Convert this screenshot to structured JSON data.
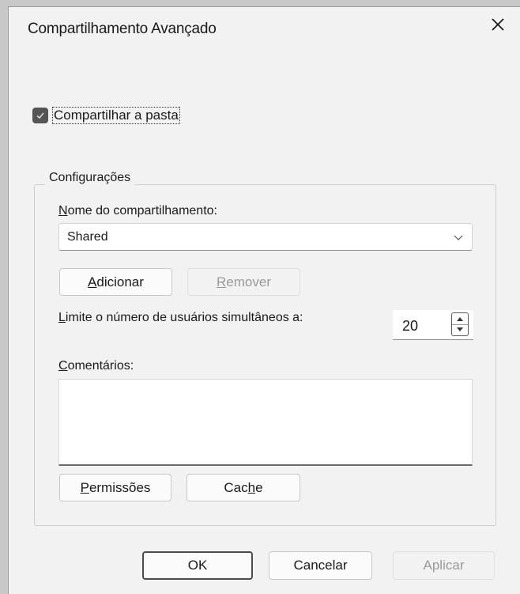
{
  "dialog": {
    "title": "Compartilhamento Avançado",
    "close_icon": "close-icon"
  },
  "share_checkbox": {
    "checked": true,
    "label": "Compartilhar a pasta"
  },
  "settings": {
    "legend": "Configurações",
    "share_name": {
      "label_mnemonic": "N",
      "label_rest": "ome do compartilhamento:",
      "value": "Shared"
    },
    "add_button": {
      "mnemonic": "A",
      "rest": "dicionar"
    },
    "remove_button": {
      "mnemonic": "R",
      "rest": "emover",
      "disabled": true
    },
    "user_limit": {
      "label_mnemonic": "L",
      "label_rest": "imite o número de usuários simultâneos a:",
      "value": "20"
    },
    "comments": {
      "label_mnemonic": "C",
      "label_rest": "omentários:",
      "value": ""
    },
    "permissions_button": {
      "mnemonic": "P",
      "rest": "ermissões"
    },
    "cache_button": {
      "pre": "Cac",
      "mnemonic": "h",
      "post": "e"
    }
  },
  "footer": {
    "ok": "OK",
    "cancel": "Cancelar",
    "apply": "Aplicar"
  },
  "colors": {
    "dialog_bg": "#f2f2f2",
    "checkbox_fill": "#555555",
    "disabled_text": "#9a9a9a"
  }
}
